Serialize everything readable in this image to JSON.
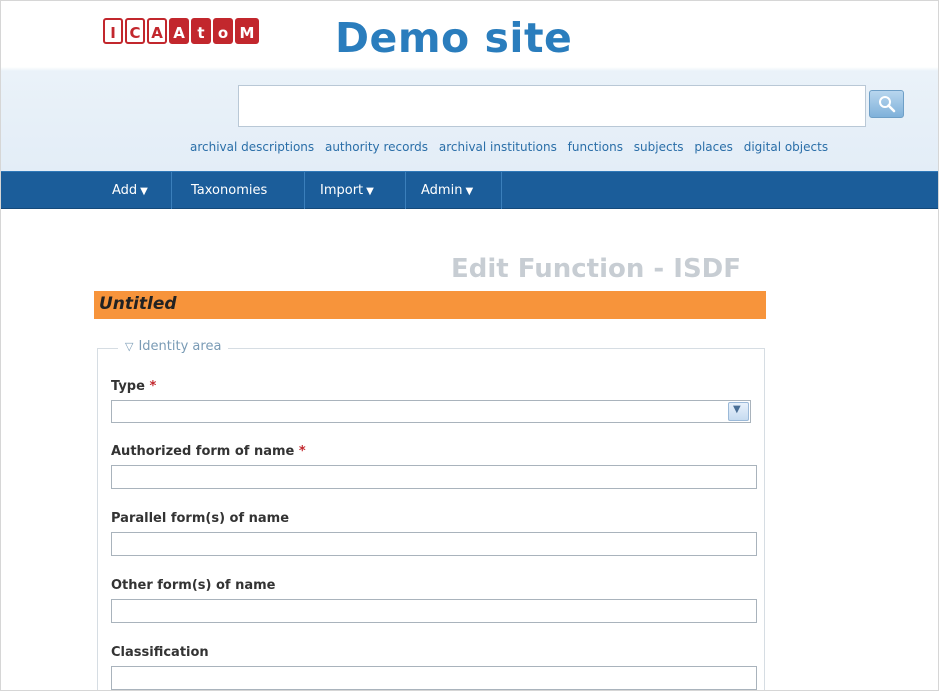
{
  "logo": {
    "letters": [
      "I",
      "C",
      "A",
      "A",
      "t",
      "o",
      "M"
    ]
  },
  "site": {
    "title": "Demo site"
  },
  "search": {
    "value": ""
  },
  "browse": {
    "links": [
      "archival descriptions",
      "authority records",
      "archival institutions",
      "functions",
      "subjects",
      "places",
      "digital objects"
    ]
  },
  "nav": {
    "items": [
      {
        "label": "Add",
        "dropdown": "▼"
      },
      {
        "label": "Taxonomies",
        "dropdown": ""
      },
      {
        "label": "Import",
        "dropdown": "▼"
      },
      {
        "label": "Admin",
        "dropdown": "▼"
      }
    ]
  },
  "page": {
    "heading": "Edit Function - ISDF",
    "record_title": "Untitled"
  },
  "form": {
    "area_title": "Identity area",
    "area_toggle_icon": "▽",
    "required_marker": "*",
    "fields": [
      {
        "label": "Type",
        "value": ""
      },
      {
        "label": "Authorized form of name",
        "value": ""
      },
      {
        "label": "Parallel form(s) of name",
        "value": ""
      },
      {
        "label": "Other form(s) of name",
        "value": ""
      },
      {
        "label": "Classification",
        "value": ""
      }
    ]
  },
  "colors": {
    "brand_blue": "#2a7dbd",
    "nav_bar": "#1b5d9a",
    "title_bar": "#f7943b",
    "logo_red": "#c2272d"
  }
}
